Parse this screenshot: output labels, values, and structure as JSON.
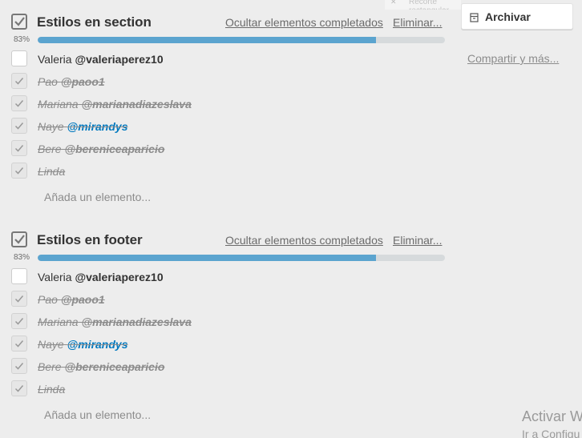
{
  "checklists": [
    {
      "title": "Estilos en section",
      "hide_completed": "Ocultar elementos completados",
      "delete": "Eliminar...",
      "progress_label": "83%",
      "progress": 0.83,
      "items": [
        {
          "name": "Valeria",
          "mention": "@valeriaperez10",
          "done": false,
          "link": false
        },
        {
          "name": "Pao",
          "mention": "@paoo1",
          "done": true,
          "link": false
        },
        {
          "name": "Mariana",
          "mention": "@marianadiazeslava",
          "done": true,
          "link": false
        },
        {
          "name": "Naye",
          "mention": "@mirandys",
          "done": true,
          "link": true
        },
        {
          "name": "Bere",
          "mention": "@bereniceaparicio",
          "done": true,
          "link": false
        },
        {
          "name": "Linda",
          "mention": "",
          "done": true,
          "link": false
        }
      ],
      "add_item": "Añada un elemento..."
    },
    {
      "title": "Estilos en footer",
      "hide_completed": "Ocultar elementos completados",
      "delete": "Eliminar...",
      "progress_label": "83%",
      "progress": 0.83,
      "items": [
        {
          "name": "Valeria",
          "mention": "@valeriaperez10",
          "done": false,
          "link": false
        },
        {
          "name": "Pao",
          "mention": "@paoo1",
          "done": true,
          "link": false
        },
        {
          "name": "Mariana",
          "mention": "@marianadiazeslava",
          "done": true,
          "link": false
        },
        {
          "name": "Naye",
          "mention": "@mirandys",
          "done": true,
          "link": true
        },
        {
          "name": "Bere",
          "mention": "@bereniceaparicio",
          "done": true,
          "link": false
        },
        {
          "name": "Linda",
          "mention": "",
          "done": true,
          "link": false
        }
      ],
      "add_item": "Añada un elemento..."
    }
  ],
  "sidebar": {
    "archive_label": "Archivar",
    "archive_icon": "archive-icon",
    "share_label": "Compartir y más..."
  },
  "ghost_tooltip": "Recorte rectangular",
  "watermark": {
    "line1": "Activar W",
    "line2": "Ir a Configu"
  },
  "colors": {
    "progress_fill": "#5ba4cf",
    "progress_track": "#d6dadc",
    "mention_link": "#0079bf"
  }
}
